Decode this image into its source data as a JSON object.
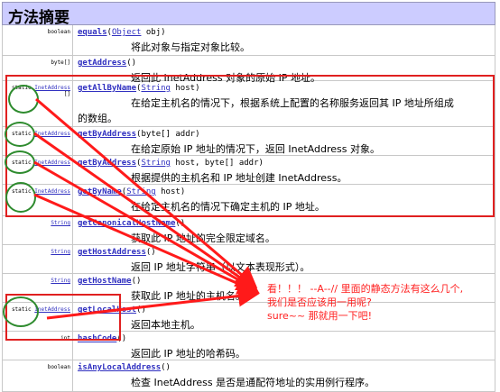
{
  "section_title": "方法摘要",
  "rows": [
    {
      "mod": "",
      "type": "boolean",
      "type_link": false,
      "name": "equals",
      "params": [
        {
          "type": "Object",
          "rest": " obj"
        }
      ],
      "desc": "将此对象与指定对象比较。"
    },
    {
      "mod": "",
      "type": "byte[]",
      "type_link": false,
      "name": "getAddress",
      "params": [],
      "desc": "返回此 InetAddress 对象的原始 IP 地址。"
    },
    {
      "mod": "static",
      "type": "InetAddress",
      "type_link": true,
      "type2": "[]",
      "name": "getAllByName",
      "params": [
        {
          "type": "String",
          "rest": " host"
        }
      ],
      "desc": "在给定主机名的情况下，根据系统上配置的名称服务返回其 IP 地址所组成",
      "desc_line2": "的数组。"
    },
    {
      "mod": "static",
      "type": "InetAddress",
      "type_link": true,
      "name": "getByAddress",
      "params": [
        {
          "type": "",
          "rest": "byte[] addr"
        }
      ],
      "desc": "在给定原始 IP 地址的情况下，返回 InetAddress 对象。"
    },
    {
      "mod": "static",
      "type": "InetAddress",
      "type_link": true,
      "name": "getByAddress",
      "params": [
        {
          "type": "String",
          "rest": " host, byte[] addr"
        }
      ],
      "desc": "根据提供的主机名和 IP 地址创建 InetAddress。"
    },
    {
      "mod": "static",
      "type": "InetAddress",
      "type_link": true,
      "name": "getByName",
      "params": [
        {
          "type": "String",
          "rest": " host"
        }
      ],
      "desc": "在给定主机名的情况下确定主机的 IP 地址。"
    },
    {
      "mod": "",
      "type": "String",
      "type_link": true,
      "name": "getCanonicalHostName",
      "params": [],
      "desc": "获取此 IP 地址的完全限定域名。"
    },
    {
      "mod": "",
      "type": "String",
      "type_link": true,
      "name": "getHostAddress",
      "params": [],
      "desc": "返回 IP 地址字符串（以文本表现形式）。"
    },
    {
      "mod": "",
      "type": "String",
      "type_link": true,
      "name": "getHostName",
      "params": [],
      "desc": "获取此 IP 地址的主机名。"
    },
    {
      "mod": "static",
      "type": "InetAddress",
      "type_link": true,
      "name": "getLocalHost",
      "params": [],
      "desc": "返回本地主机。"
    },
    {
      "mod": "",
      "type": "int",
      "type_link": false,
      "name": "hashCode",
      "params": [],
      "desc": "返回此 IP 地址的哈希码。"
    },
    {
      "mod": "",
      "type": "boolean",
      "type_link": false,
      "name": "isAnyLocalAddress",
      "params": [],
      "desc": "检查 InetAddress 是否是通配符地址的实用例行程序。"
    }
  ],
  "annotation": {
    "line1": "看！！！   --A--//  里面的静态方法有这么几个,",
    "line2": "我们是否应该用一用呢?",
    "line3": "sure~~  那就用一下吧!"
  },
  "colors": {
    "highlight_box": "#e02020",
    "circle": "#2e8b2e",
    "annotation_text": "#ff2020",
    "header_bg": "#ccccff",
    "link": "#3030c0"
  }
}
